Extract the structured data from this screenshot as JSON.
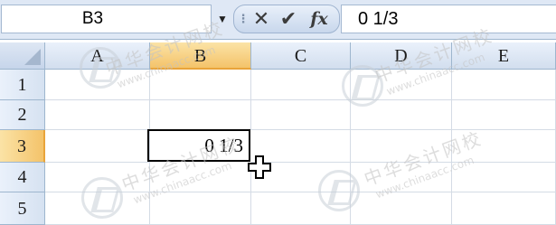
{
  "formula_bar": {
    "name_box_value": "B3",
    "name_box_arrow": "▼",
    "cancel_icon": "✕",
    "enter_icon": "✔",
    "function_label": "fx",
    "formula_value": "0 1/3"
  },
  "grid": {
    "columns": [
      "A",
      "B",
      "C",
      "D",
      "E"
    ],
    "rows": [
      "1",
      "2",
      "3",
      "4",
      "5"
    ],
    "active_column": "B",
    "active_row": "3",
    "active_cell_value": "0 1/3"
  },
  "cursor": {
    "icon": "cross-cursor-icon"
  },
  "watermark": {
    "chinese": "中华会计网校",
    "url": "www.chinaacc.com"
  },
  "colors": {
    "accent_header": "#f4c36a",
    "grid_line": "#d4dbe5",
    "header_border": "#9eb6ce"
  }
}
